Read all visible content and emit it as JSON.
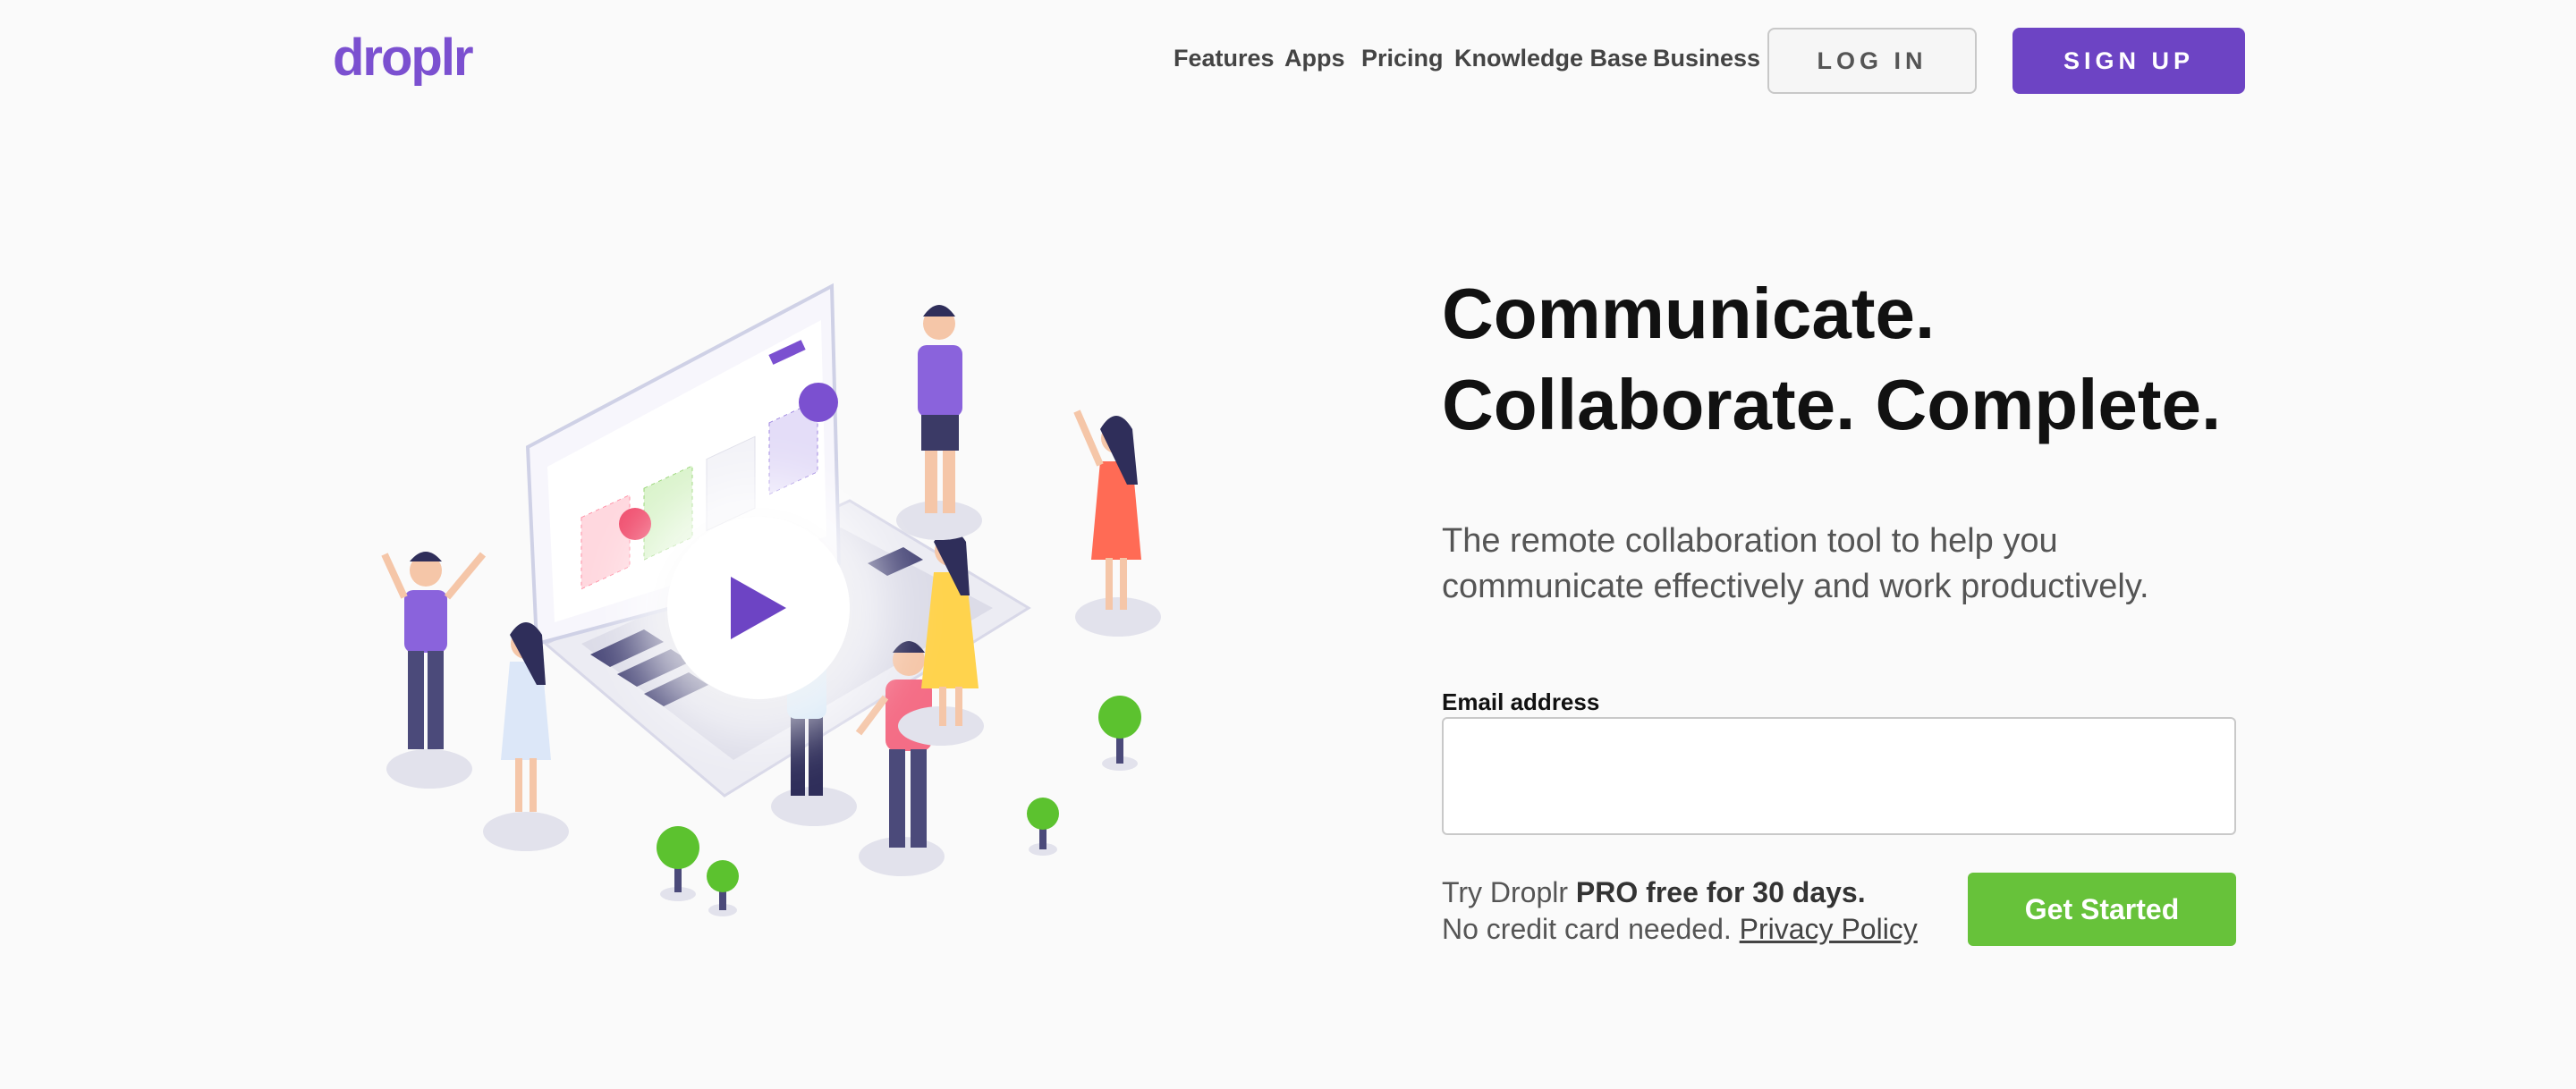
{
  "header": {
    "logo_text": "droplr",
    "nav": [
      {
        "label": "Features"
      },
      {
        "label": "Apps"
      },
      {
        "label": "Pricing"
      },
      {
        "label": "Knowledge Base"
      },
      {
        "label": "Business"
      }
    ],
    "login_label": "LOG IN",
    "signup_label": "SIGN UP"
  },
  "hero": {
    "headline_line1": "Communicate.",
    "headline_line2": "Collaborate. Complete.",
    "subtext": "The remote collaboration tool to help you communicate effectively and work productively.",
    "play_icon": "play-icon"
  },
  "form": {
    "email_label": "Email address",
    "email_value": "",
    "email_placeholder": "",
    "promo_prefix": "Try Droplr ",
    "promo_bold": "PRO free for 30 days.",
    "promo_line2": "No credit card needed. ",
    "privacy_link": "Privacy Policy",
    "cta_label": "Get Started"
  },
  "colors": {
    "brand_purple": "#6d44c4",
    "cta_green": "#67c23a",
    "background": "#fafafa"
  }
}
